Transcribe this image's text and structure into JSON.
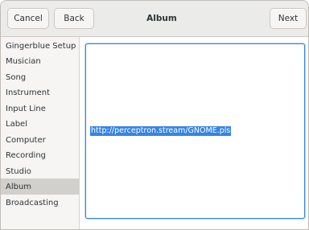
{
  "header": {
    "cancel_label": "Cancel",
    "back_label": "Back",
    "title": "Album",
    "next_label": "Next"
  },
  "sidebar": {
    "items": [
      {
        "label": "Gingerblue Setup"
      },
      {
        "label": "Musician"
      },
      {
        "label": "Song"
      },
      {
        "label": "Instrument"
      },
      {
        "label": "Input Line"
      },
      {
        "label": "Label"
      },
      {
        "label": "Computer"
      },
      {
        "label": "Recording"
      },
      {
        "label": "Studio"
      },
      {
        "label": "Album",
        "selected": true
      },
      {
        "label": "Broadcasting"
      }
    ]
  },
  "content": {
    "text": "http://perceptron.stream/GNOME.pls",
    "selection_color": "#3584e4"
  },
  "colors": {
    "accent": "#3584e4",
    "header_bg": "#ebebea",
    "sidebar_bg": "#f6f5f4",
    "selected_row_bg": "#d2d0cc"
  }
}
